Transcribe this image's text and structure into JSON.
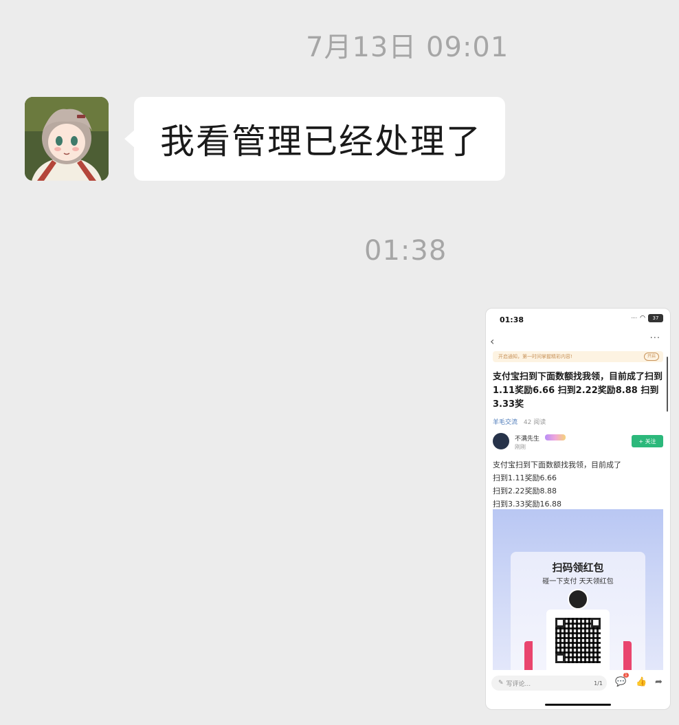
{
  "chat": {
    "timestamp_1": "7月13日 09:01",
    "timestamp_2": "01:38",
    "message_1": "我看管理已经处理了"
  },
  "screenshot": {
    "status_time": "01:38",
    "battery": "37",
    "notice_text": "开启通知，第一时间掌握精彩内容!",
    "notice_button": "开启",
    "title": "支付宝扫到下面数额找我领，目前成了扫到1.11奖励6.66 扫到2.22奖励8.88 扫到3.33奖",
    "category": "羊毛交流",
    "reads": "42 阅读",
    "author": "不满先生",
    "author_time": "刚刚",
    "follow_label": "+ 关注",
    "body_lines": [
      "支付宝扫到下面数额找我领，目前成了",
      "扫到1.11奖励6.66",
      "扫到2.22奖励8.88",
      "扫到3.33奖励16.88"
    ],
    "poster_title": "扫码领红包",
    "poster_sub": "碰一下支付 天天领红包",
    "comment_placeholder": "写评论...",
    "page_indicator": "1/1",
    "comment_count": "1"
  }
}
